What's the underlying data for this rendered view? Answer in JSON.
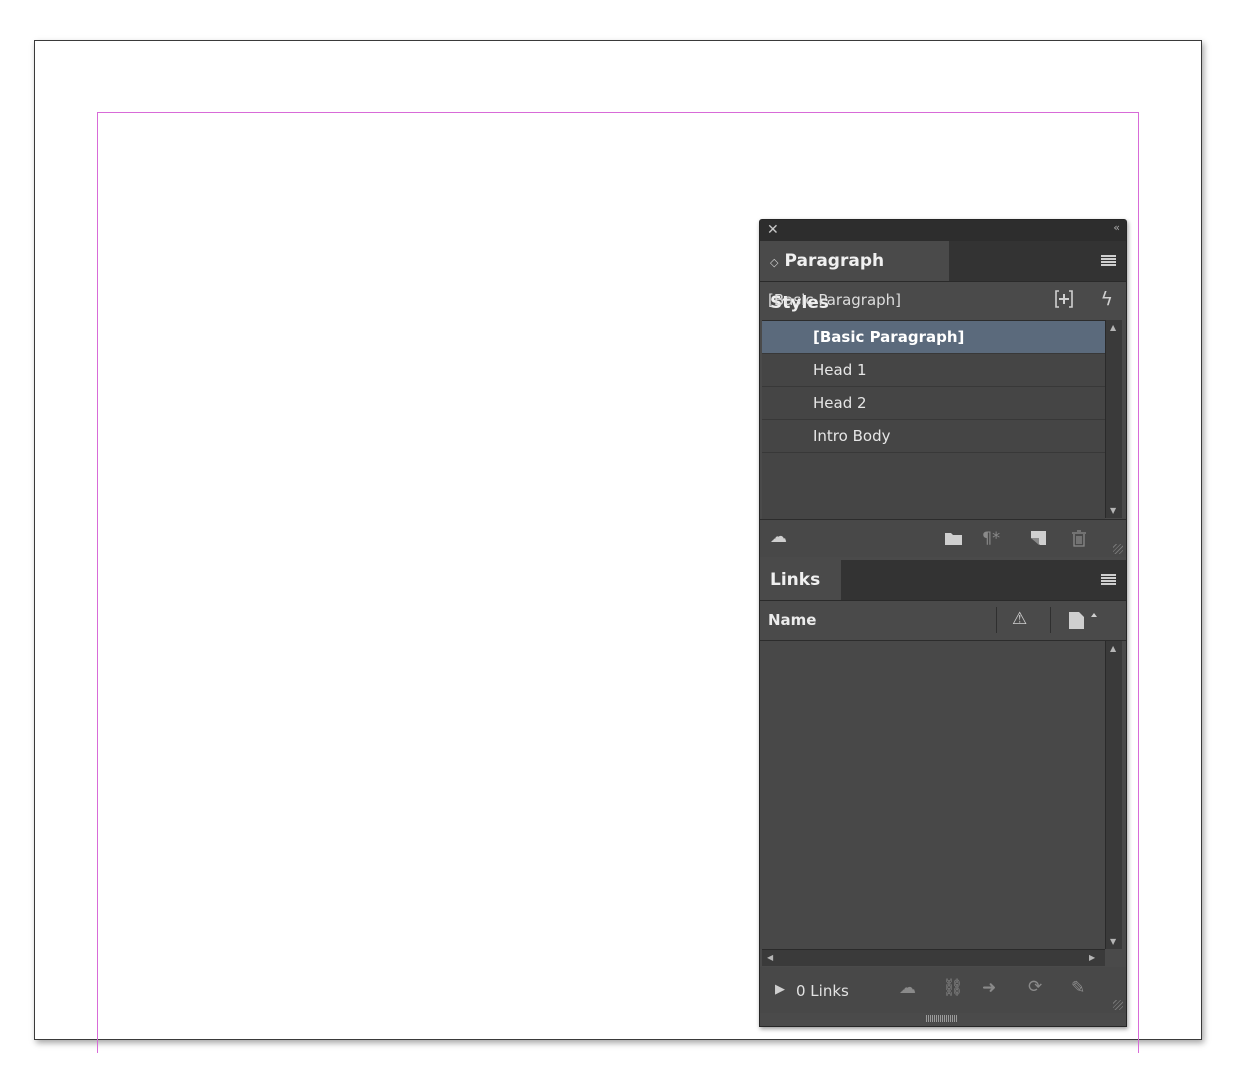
{
  "paragraph_styles": {
    "tab_label": "Paragraph Styles",
    "current_style": "[Basic Paragraph]",
    "items": [
      {
        "label": "[Basic Paragraph]",
        "selected": true
      },
      {
        "label": "Head 1",
        "selected": false
      },
      {
        "label": "Head 2",
        "selected": false
      },
      {
        "label": "Intro Body",
        "selected": false
      }
    ]
  },
  "links": {
    "tab_label": "Links",
    "column_name": "Name",
    "count_label": "0 Links"
  },
  "colors": {
    "panel_bg": "#4a4a4a",
    "selected_row": "#5b6a7c",
    "margin_guide": "#d86bd8"
  }
}
